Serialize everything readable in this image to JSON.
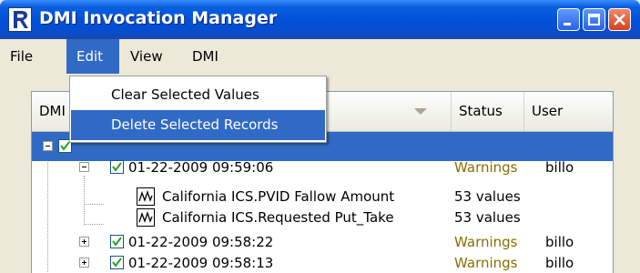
{
  "window": {
    "title": "DMI Invocation Manager"
  },
  "menubar": {
    "items": [
      "File",
      "Edit",
      "View",
      "DMI"
    ]
  },
  "edit_menu": {
    "items": [
      "Clear Selected Values",
      "Delete Selected Records"
    ],
    "highlighted_index": 1
  },
  "table": {
    "columns": [
      "DMI",
      "Status",
      "User"
    ],
    "rows": [
      {
        "label": "",
        "status": "",
        "user": "",
        "checked": true,
        "selected": true
      },
      {
        "label": "01-22-2009 09:59:06",
        "status": "Warnings",
        "user": "billo",
        "checked": true,
        "expanded": true
      },
      {
        "label": "California ICS.PVID Fallow Amount",
        "status": "53 values",
        "user": "",
        "icon": "graph-icon"
      },
      {
        "label": "California ICS.Requested Put_Take",
        "status": "53 values",
        "user": "",
        "icon": "graph-icon"
      },
      {
        "label": "01-22-2009 09:58:22",
        "status": "Warnings",
        "user": "billo",
        "checked": true,
        "expanded": false
      },
      {
        "label": "01-22-2009 09:58:13",
        "status": "Warnings",
        "user": "billo",
        "checked": true,
        "expanded": false
      }
    ]
  },
  "colors": {
    "title_bar": "#0050d8",
    "selection": "#316ac5",
    "warning_text": "#8a6d00"
  }
}
